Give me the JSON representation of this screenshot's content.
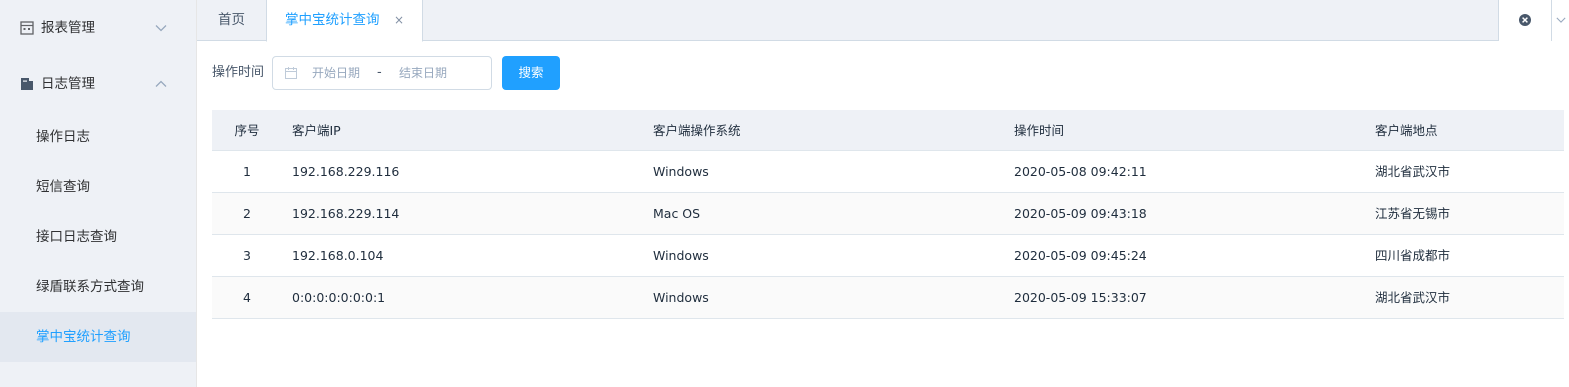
{
  "sidebar": {
    "groups": [
      {
        "label": "报表管理",
        "icon": "report-icon",
        "expanded": false
      },
      {
        "label": "日志管理",
        "icon": "log-icon",
        "expanded": true
      }
    ],
    "items": [
      {
        "label": "操作日志",
        "active": false
      },
      {
        "label": "短信查询",
        "active": false
      },
      {
        "label": "接口日志查询",
        "active": false
      },
      {
        "label": "绿盾联系方式查询",
        "active": false
      },
      {
        "label": "掌中宝统计查询",
        "active": true
      }
    ]
  },
  "tabs": {
    "home_label": "首页",
    "active_label": "掌中宝统计查询",
    "close_glyph": "×"
  },
  "filter": {
    "label": "操作时间",
    "start_placeholder": "开始日期",
    "separator": "-",
    "end_placeholder": "结束日期",
    "search_label": "搜索"
  },
  "table": {
    "columns": [
      "序号",
      "客户端IP",
      "客户端操作系统",
      "操作时间",
      "客户端地点"
    ],
    "rows": [
      [
        "1",
        "192.168.229.116",
        "Windows",
        "2020-05-08 09:42:11",
        "湖北省武汉市"
      ],
      [
        "2",
        "192.168.229.114",
        "Mac OS",
        "2020-05-09 09:43:18",
        "江苏省无锡市"
      ],
      [
        "3",
        "192.168.0.104",
        "Windows",
        "2020-05-09 09:45:24",
        "四川省成都市"
      ],
      [
        "4",
        "0:0:0:0:0:0:0:1",
        "Windows",
        "2020-05-09 15:33:07",
        "湖北省武汉市"
      ]
    ]
  },
  "colors": {
    "accent": "#20a0ff",
    "sidebar_bg": "#eef1f6",
    "active_item_bg": "#e3e8f0"
  }
}
